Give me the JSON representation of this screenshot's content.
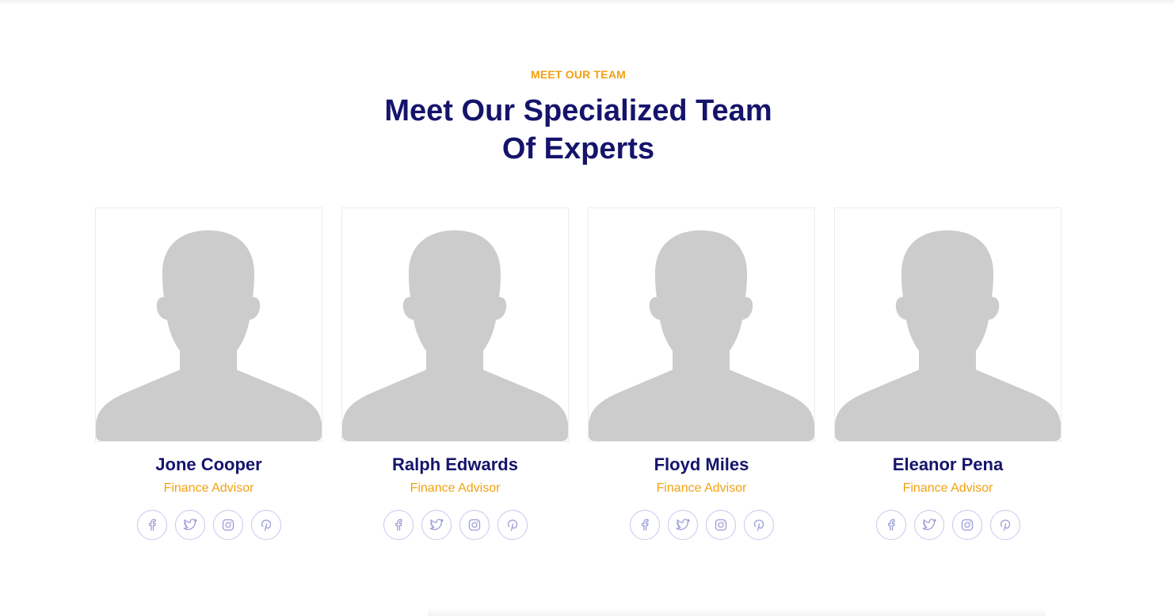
{
  "section": {
    "eyebrow": "MEET OUR TEAM",
    "heading_line1": "Meet Our Specialized Team",
    "heading_line2": "Of Experts"
  },
  "colors": {
    "accent": "#f2a10f",
    "heading": "#15146b",
    "social_border": "#c9c8ee",
    "placeholder": "#cccccc"
  },
  "team": [
    {
      "name": "Jone Cooper",
      "role": "Finance Advisor",
      "image_icon": "person-placeholder-icon"
    },
    {
      "name": "Ralph Edwards",
      "role": "Finance Advisor",
      "image_icon": "person-placeholder-icon"
    },
    {
      "name": "Floyd Miles",
      "role": "Finance Advisor",
      "image_icon": "person-placeholder-icon"
    },
    {
      "name": "Eleanor Pena",
      "role": "Finance Advisor",
      "image_icon": "person-placeholder-icon"
    }
  ],
  "social_icons": [
    "facebook-icon",
    "twitter-icon",
    "instagram-icon",
    "pinterest-icon"
  ]
}
